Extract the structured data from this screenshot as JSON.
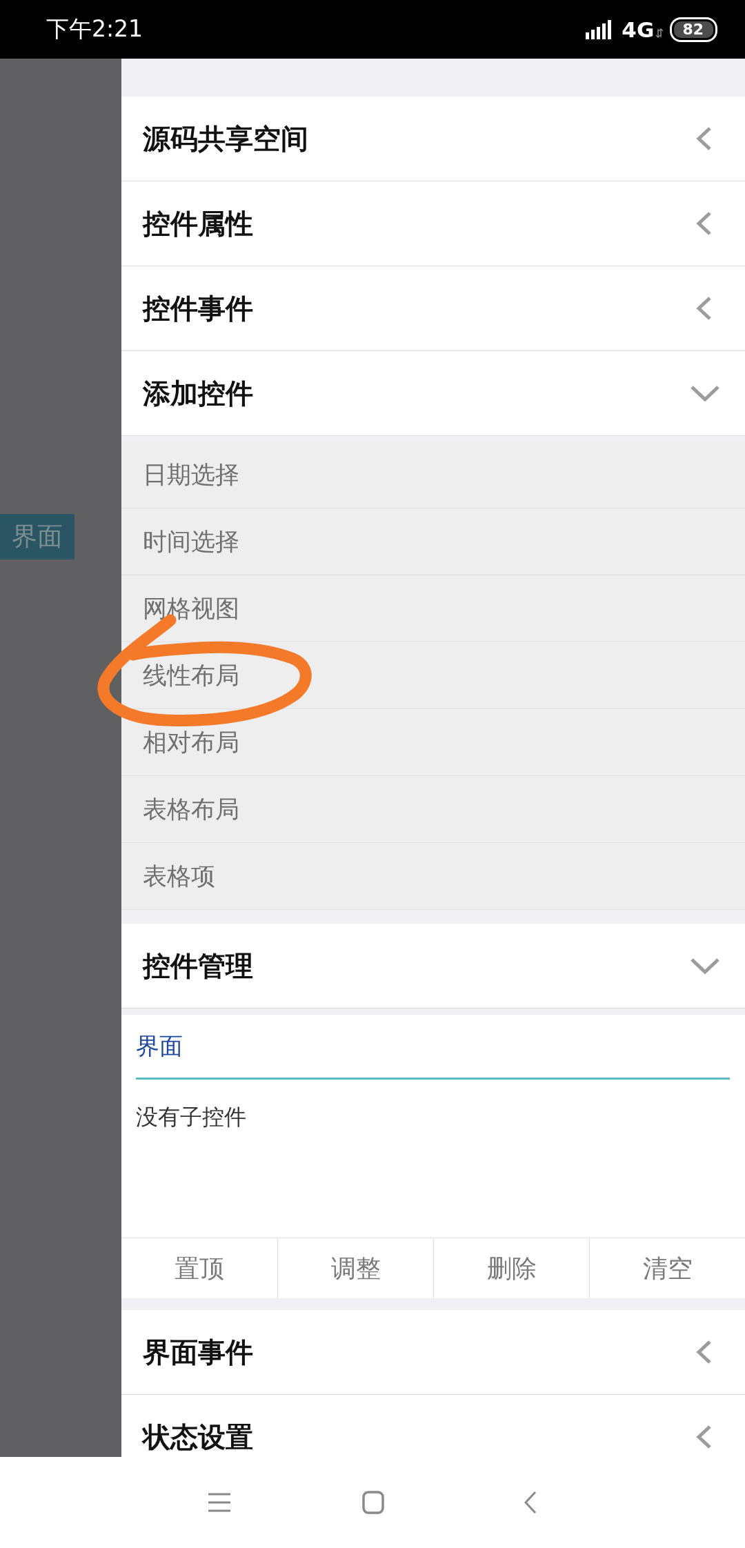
{
  "status_bar": {
    "time": "下午2:21",
    "network": "4G",
    "battery": "82"
  },
  "side_panel": {
    "tag": "界面"
  },
  "sections": [
    {
      "kind": "header",
      "title": "源码共享空间",
      "expanded": false
    },
    {
      "kind": "header",
      "title": "控件属性",
      "expanded": false
    },
    {
      "kind": "header",
      "title": "控件事件",
      "expanded": false
    },
    {
      "kind": "list",
      "title": "添加控件",
      "expanded": true,
      "items": [
        {
          "label": "日期选择",
          "circled": false
        },
        {
          "label": "时间选择",
          "circled": false
        },
        {
          "label": "网格视图",
          "circled": false
        },
        {
          "label": "线性布局",
          "circled": true
        },
        {
          "label": "相对布局",
          "circled": false
        },
        {
          "label": "表格布局",
          "circled": false
        },
        {
          "label": "表格项",
          "circled": false
        }
      ]
    },
    {
      "kind": "manager",
      "title": "控件管理",
      "expanded": true,
      "path": "界面",
      "empty_text": "没有子控件",
      "buttons": [
        "置顶",
        "调整",
        "删除",
        "清空"
      ]
    },
    {
      "kind": "header",
      "title": "界面事件",
      "expanded": false
    },
    {
      "kind": "header",
      "title": "状态设置",
      "expanded": false
    }
  ]
}
